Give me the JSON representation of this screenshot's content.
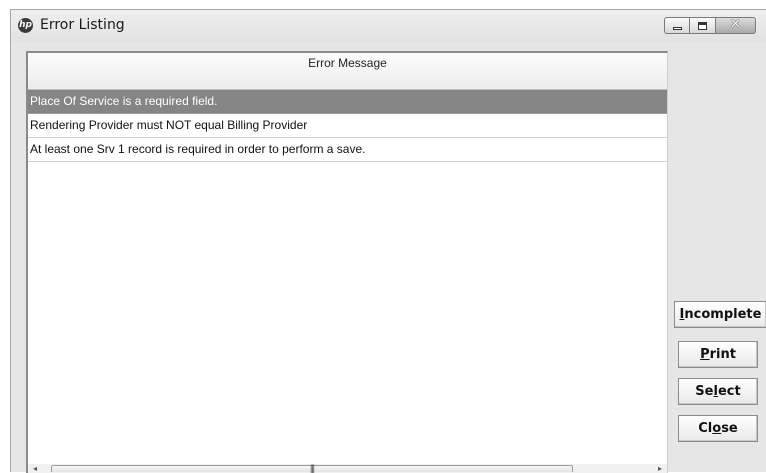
{
  "window": {
    "title": "Error Listing",
    "app_icon": "hp-logo-icon",
    "controls": {
      "minimize": "minimize-icon",
      "maximize": "maximize-icon",
      "close": "close-icon",
      "close_glyph": "✕"
    }
  },
  "error_grid": {
    "column_header": "Error Message",
    "rows": [
      {
        "message": "Place Of Service is a required field.",
        "selected": true
      },
      {
        "message": "Rendering Provider must NOT equal Billing Provider",
        "selected": false
      },
      {
        "message": "At least one Srv 1 record is required in order to perform a save.",
        "selected": false
      }
    ],
    "scrollbar_grip": "|||"
  },
  "buttons": {
    "incomplete": {
      "label": "Incomplete",
      "accesskey": "I"
    },
    "print": {
      "label": "Print",
      "accesskey": "P"
    },
    "select": {
      "label": "Select",
      "accesskey": "l"
    },
    "close": {
      "label": "Close",
      "accesskey": "o"
    }
  },
  "colors": {
    "selected_row": "#858585",
    "window_bg": "#e6e6e6"
  }
}
